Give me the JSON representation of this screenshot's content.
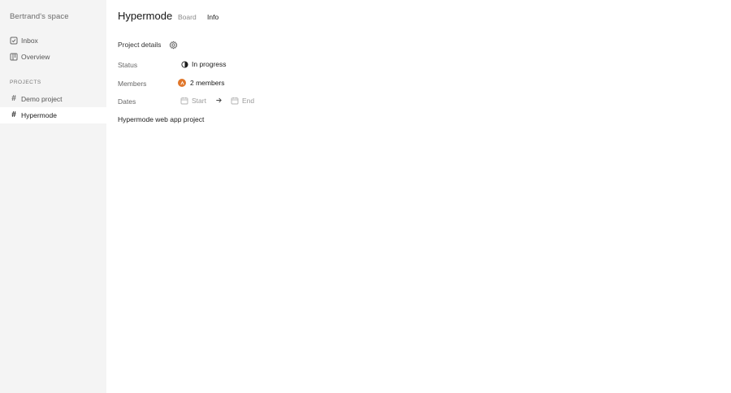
{
  "sidebar": {
    "workspace_name": "Bertrand's space",
    "nav": [
      {
        "label": "Inbox",
        "icon": "checkbox-icon"
      },
      {
        "label": "Overview",
        "icon": "board-icon"
      }
    ],
    "projects_title": "PROJECTS",
    "projects": [
      {
        "label": "Demo project",
        "icon": "hash-icon",
        "active": false
      },
      {
        "label": "Hypermode",
        "icon": "hash-icon",
        "active": true
      }
    ]
  },
  "header": {
    "title": "Hypermode",
    "tabs": [
      {
        "label": "Board",
        "active": false
      },
      {
        "label": "Info",
        "active": true
      }
    ]
  },
  "details": {
    "title": "Project details",
    "rows": {
      "status": {
        "label": "Status",
        "value": "In progress",
        "icon": "half-circle-icon"
      },
      "members": {
        "label": "Members",
        "value": "2 members",
        "icon": "avatar-icon"
      },
      "dates": {
        "label": "Dates",
        "start": "Start",
        "end": "End",
        "icon": "calendar-icon"
      }
    },
    "description": "Hypermode web app project"
  },
  "colors": {
    "sidebar_bg": "#f4f4f4",
    "avatar": "#e0762a",
    "text_muted": "#9a9a9a"
  }
}
